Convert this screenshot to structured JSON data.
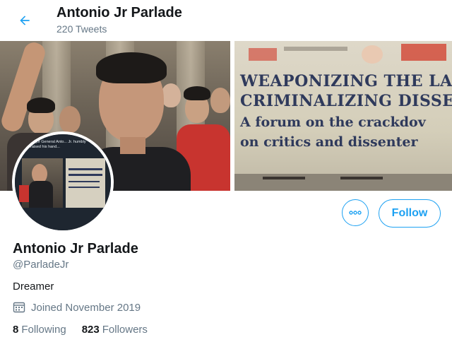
{
  "header": {
    "name": "Antonio Jr Parlade",
    "tweet_count": "220 Tweets"
  },
  "banner": {
    "sign_lines": [
      "WEAPONIZING THE LA",
      "CRIMINALIZING DISSE",
      "A forum on the crackdov",
      "on critics and dissenter"
    ]
  },
  "avatar": {
    "caption": "Major General Anto... Jr. humbly raised his hand..."
  },
  "actions": {
    "follow_label": "Follow"
  },
  "profile": {
    "name": "Antonio Jr Parlade",
    "handle": "@ParladeJr",
    "bio": "Dreamer",
    "joined": "Joined November 2019",
    "following_count": "8",
    "following_label": "Following",
    "followers_count": "823",
    "followers_label": "Followers"
  },
  "colors": {
    "accent": "#1da1f2",
    "muted": "#657786",
    "text": "#14171a"
  }
}
